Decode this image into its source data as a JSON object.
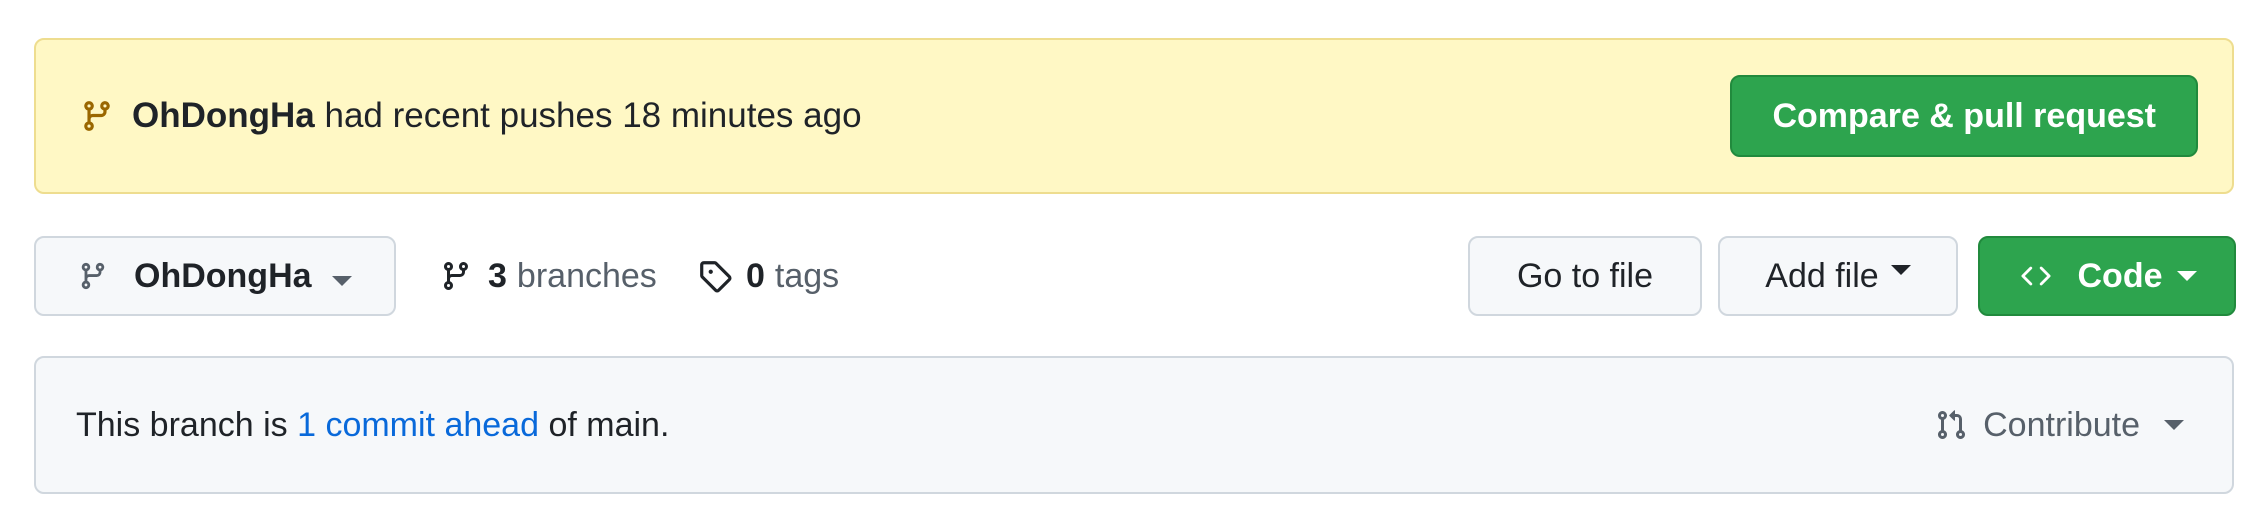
{
  "banner": {
    "user": "OhDongHa",
    "message": "had recent pushes 18 minutes ago",
    "button_label": "Compare & pull request",
    "icon": "git-branch-icon"
  },
  "toolbar": {
    "branch_selector": {
      "label": "OhDongHa",
      "icon": "git-branch-icon"
    },
    "branches": {
      "count": "3",
      "label": "branches",
      "icon": "git-branch-icon"
    },
    "tags": {
      "count": "0",
      "label": "tags",
      "icon": "tag-icon"
    },
    "go_to_file": "Go to file",
    "add_file": "Add file",
    "code": "Code"
  },
  "branch_info": {
    "prefix": "This branch is",
    "link": "1 commit ahead",
    "suffix": "of main.",
    "contribute": "Contribute"
  },
  "colors": {
    "primary_green": "#2da44e",
    "banner_bg": "#fff8c5",
    "link_blue": "#0969da"
  }
}
